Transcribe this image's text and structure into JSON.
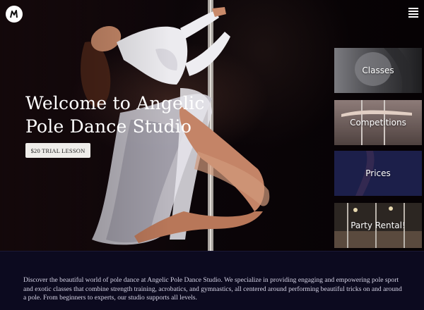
{
  "brand": {
    "logo_icon": "studio-logo-icon"
  },
  "header": {
    "menu_icon": "hamburger-menu-icon"
  },
  "hero": {
    "title_line1": "Welcome to Angelic",
    "title_line2": "Pole Dance Studio",
    "cta_label": "$20 TRIAL LESSON"
  },
  "tiles": [
    {
      "label": "Classes"
    },
    {
      "label": "Competitions"
    },
    {
      "label": "Prices"
    },
    {
      "label": "Party Rental!"
    }
  ],
  "intro_text": "Discover the beautiful world of pole dance at Angelic Pole Dance Studio. We specialize in providing engaging and empowering pole sport and exotic classes that combine strength training, acrobatics, and gymnastics, all centered around performing beautiful tricks on and around a pole. From beginners to experts, our studio supports all levels.",
  "colors": {
    "page_bg": "#0c0a1f",
    "button_bg": "#efedea",
    "tile_prices": "#1c1f4a"
  }
}
